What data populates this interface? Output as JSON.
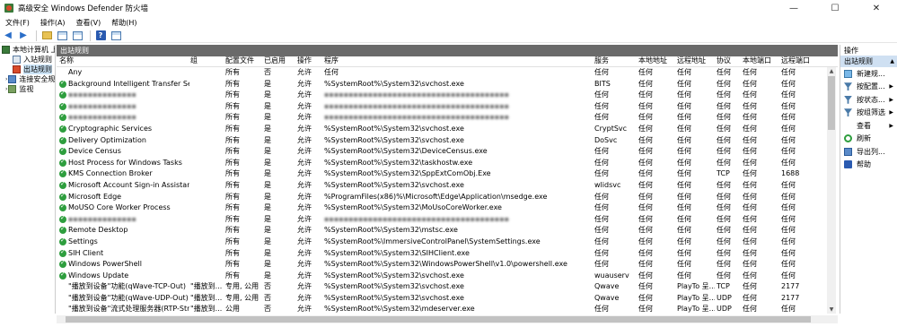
{
  "window": {
    "title": "高级安全 Windows Defender 防火墙",
    "controls": [
      "—",
      "☐",
      "✕"
    ]
  },
  "menu": [
    "文件(F)",
    "操作(A)",
    "查看(V)",
    "帮助(H)"
  ],
  "tree": [
    {
      "label": "本地计算机 上",
      "icon": "root"
    },
    {
      "label": "入站规则",
      "icon": "in"
    },
    {
      "label": "出站规则",
      "icon": "out",
      "selected": true
    },
    {
      "label": "连接安全规",
      "icon": "conn"
    },
    {
      "label": "监视",
      "icon": "mon"
    }
  ],
  "pane": {
    "title": "出站规则",
    "columns": [
      "名称",
      "组",
      "配置文件",
      "已启用",
      "操作",
      "程序",
      "服务",
      "本地地址",
      "远程地址",
      "协议",
      "本地端口",
      "远程端口"
    ],
    "rows": [
      {
        "check": false,
        "name": "Any",
        "group": "",
        "profile": "所有",
        "enabled": "否",
        "action": "允许",
        "program": "任何",
        "service": "任何",
        "local_addr": "任何",
        "remote_addr": "任何",
        "protocol": "任何",
        "local_port": "任何",
        "remote_port": "任何"
      },
      {
        "check": true,
        "name": "Background Intelligent Transfer Service",
        "group": "",
        "profile": "所有",
        "enabled": "是",
        "action": "允许",
        "program": "%SystemRoot%\\System32\\svchost.exe",
        "service": "BITS",
        "local_addr": "任何",
        "remote_addr": "任何",
        "protocol": "任何",
        "local_port": "任何",
        "remote_port": "任何"
      },
      {
        "check": true,
        "name": "",
        "blur_name": true,
        "group": "",
        "profile": "所有",
        "enabled": "是",
        "action": "允许",
        "program": "",
        "blur_program": true,
        "service": "任何",
        "local_addr": "任何",
        "remote_addr": "任何",
        "protocol": "任何",
        "local_port": "任何",
        "remote_port": "任何"
      },
      {
        "check": true,
        "name": "",
        "blur_name": true,
        "group": "",
        "profile": "所有",
        "enabled": "是",
        "action": "允许",
        "program": "",
        "blur_program": true,
        "service": "任何",
        "local_addr": "任何",
        "remote_addr": "任何",
        "protocol": "任何",
        "local_port": "任何",
        "remote_port": "任何"
      },
      {
        "check": true,
        "name": "",
        "blur_name": true,
        "group": "",
        "profile": "所有",
        "enabled": "是",
        "action": "允许",
        "program": "",
        "blur_program": true,
        "service": "任何",
        "local_addr": "任何",
        "remote_addr": "任何",
        "protocol": "任何",
        "local_port": "任何",
        "remote_port": "任何"
      },
      {
        "check": true,
        "name": "Cryptographic Services",
        "group": "",
        "profile": "所有",
        "enabled": "是",
        "action": "允许",
        "program": "%SystemRoot%\\System32\\svchost.exe",
        "service": "CryptSvc",
        "local_addr": "任何",
        "remote_addr": "任何",
        "protocol": "任何",
        "local_port": "任何",
        "remote_port": "任何"
      },
      {
        "check": true,
        "name": "Delivery Optimization",
        "group": "",
        "profile": "所有",
        "enabled": "是",
        "action": "允许",
        "program": "%SystemRoot%\\System32\\svchost.exe",
        "service": "DoSvc",
        "local_addr": "任何",
        "remote_addr": "任何",
        "protocol": "任何",
        "local_port": "任何",
        "remote_port": "任何"
      },
      {
        "check": true,
        "name": "Device Census",
        "group": "",
        "profile": "所有",
        "enabled": "是",
        "action": "允许",
        "program": "%SystemRoot%\\System32\\DeviceCensus.exe",
        "service": "任何",
        "local_addr": "任何",
        "remote_addr": "任何",
        "protocol": "任何",
        "local_port": "任何",
        "remote_port": "任何"
      },
      {
        "check": true,
        "name": "Host Process for Windows Tasks",
        "group": "",
        "profile": "所有",
        "enabled": "是",
        "action": "允许",
        "program": "%SystemRoot%\\System32\\taskhostw.exe",
        "service": "任何",
        "local_addr": "任何",
        "remote_addr": "任何",
        "protocol": "任何",
        "local_port": "任何",
        "remote_port": "任何"
      },
      {
        "check": true,
        "name": "KMS Connection Broker",
        "group": "",
        "profile": "所有",
        "enabled": "是",
        "action": "允许",
        "program": "%SystemRoot%\\System32\\SppExtComObj.Exe",
        "service": "任何",
        "local_addr": "任何",
        "remote_addr": "任何",
        "protocol": "TCP",
        "local_port": "任何",
        "remote_port": "1688"
      },
      {
        "check": true,
        "name": "Microsoft Account Sign-in Assistant",
        "group": "",
        "profile": "所有",
        "enabled": "是",
        "action": "允许",
        "program": "%SystemRoot%\\System32\\svchost.exe",
        "service": "wlidsvc",
        "local_addr": "任何",
        "remote_addr": "任何",
        "protocol": "任何",
        "local_port": "任何",
        "remote_port": "任何"
      },
      {
        "check": true,
        "name": "Microsoft Edge",
        "group": "",
        "profile": "所有",
        "enabled": "是",
        "action": "允许",
        "program": "%ProgramFiles(x86)%\\Microsoft\\Edge\\Application\\msedge.exe",
        "service": "任何",
        "local_addr": "任何",
        "remote_addr": "任何",
        "protocol": "任何",
        "local_port": "任何",
        "remote_port": "任何"
      },
      {
        "check": true,
        "name": "MoUSO Core Worker Process",
        "group": "",
        "profile": "所有",
        "enabled": "是",
        "action": "允许",
        "program": "%SystemRoot%\\System32\\MoUsoCoreWorker.exe",
        "service": "任何",
        "local_addr": "任何",
        "remote_addr": "任何",
        "protocol": "任何",
        "local_port": "任何",
        "remote_port": "任何"
      },
      {
        "check": true,
        "name": "",
        "blur_name": true,
        "group": "",
        "profile": "所有",
        "enabled": "是",
        "action": "允许",
        "program": "",
        "blur_program": true,
        "service": "任何",
        "local_addr": "任何",
        "remote_addr": "任何",
        "protocol": "任何",
        "local_port": "任何",
        "remote_port": "任何"
      },
      {
        "check": true,
        "name": "Remote Desktop",
        "group": "",
        "profile": "所有",
        "enabled": "是",
        "action": "允许",
        "program": "%SystemRoot%\\System32\\mstsc.exe",
        "service": "任何",
        "local_addr": "任何",
        "remote_addr": "任何",
        "protocol": "任何",
        "local_port": "任何",
        "remote_port": "任何"
      },
      {
        "check": true,
        "name": "Settings",
        "group": "",
        "profile": "所有",
        "enabled": "是",
        "action": "允许",
        "program": "%SystemRoot%\\ImmersiveControlPanel\\SystemSettings.exe",
        "service": "任何",
        "local_addr": "任何",
        "remote_addr": "任何",
        "protocol": "任何",
        "local_port": "任何",
        "remote_port": "任何"
      },
      {
        "check": true,
        "name": "SIH Client",
        "group": "",
        "profile": "所有",
        "enabled": "是",
        "action": "允许",
        "program": "%SystemRoot%\\System32\\SIHClient.exe",
        "service": "任何",
        "local_addr": "任何",
        "remote_addr": "任何",
        "protocol": "任何",
        "local_port": "任何",
        "remote_port": "任何"
      },
      {
        "check": true,
        "name": "Windows PowerShell",
        "group": "",
        "profile": "所有",
        "enabled": "是",
        "action": "允许",
        "program": "%SystemRoot%\\System32\\WindowsPowerShell\\v1.0\\powershell.exe",
        "service": "任何",
        "local_addr": "任何",
        "remote_addr": "任何",
        "protocol": "任何",
        "local_port": "任何",
        "remote_port": "任何"
      },
      {
        "check": true,
        "name": "Windows Update",
        "group": "",
        "profile": "所有",
        "enabled": "是",
        "action": "允许",
        "program": "%SystemRoot%\\System32\\svchost.exe",
        "service": "wuauserv",
        "local_addr": "任何",
        "remote_addr": "任何",
        "protocol": "任何",
        "local_port": "任何",
        "remote_port": "任何"
      },
      {
        "check": false,
        "name": "\"播放到设备\"功能(qWave-TCP-Out)",
        "group": "\"播放到...",
        "profile": "专用, 公用",
        "enabled": "否",
        "action": "允许",
        "program": "%SystemRoot%\\System32\\svchost.exe",
        "service": "Qwave",
        "local_addr": "任何",
        "remote_addr": "PlayTo 呈...",
        "protocol": "TCP",
        "local_port": "任何",
        "remote_port": "2177"
      },
      {
        "check": false,
        "name": "\"播放到设备\"功能(qWave-UDP-Out)",
        "group": "\"播放到...",
        "profile": "专用, 公用",
        "enabled": "否",
        "action": "允许",
        "program": "%SystemRoot%\\System32\\svchost.exe",
        "service": "Qwave",
        "local_addr": "任何",
        "remote_addr": "PlayTo 呈...",
        "protocol": "UDP",
        "local_port": "任何",
        "remote_port": "2177"
      },
      {
        "check": false,
        "name": "\"播放到设备\"流式处理服务器(RTP-Strea...",
        "group": "\"播放到...",
        "profile": "公用",
        "enabled": "否",
        "action": "允许",
        "program": "%SystemRoot%\\System32\\mdeserver.exe",
        "service": "任何",
        "local_addr": "任何",
        "remote_addr": "PlayTo 呈...",
        "protocol": "UDP",
        "local_port": "任何",
        "remote_port": "任何"
      }
    ]
  },
  "actions": {
    "header": "操作",
    "section": "出站规则",
    "items": [
      {
        "label": "新建规...",
        "icon": "new",
        "submenu": false
      },
      {
        "label": "按配置...",
        "icon": "filter",
        "submenu": true
      },
      {
        "label": "按状态...",
        "icon": "filter",
        "submenu": true
      },
      {
        "label": "按组筛选",
        "icon": "filter",
        "submenu": true
      },
      {
        "label": "查看",
        "icon": "blank",
        "submenu": true
      },
      {
        "label": "刷新",
        "icon": "refresh",
        "submenu": false
      },
      {
        "label": "导出列...",
        "icon": "export",
        "submenu": false
      },
      {
        "label": "帮助",
        "icon": "help",
        "submenu": false
      }
    ]
  }
}
